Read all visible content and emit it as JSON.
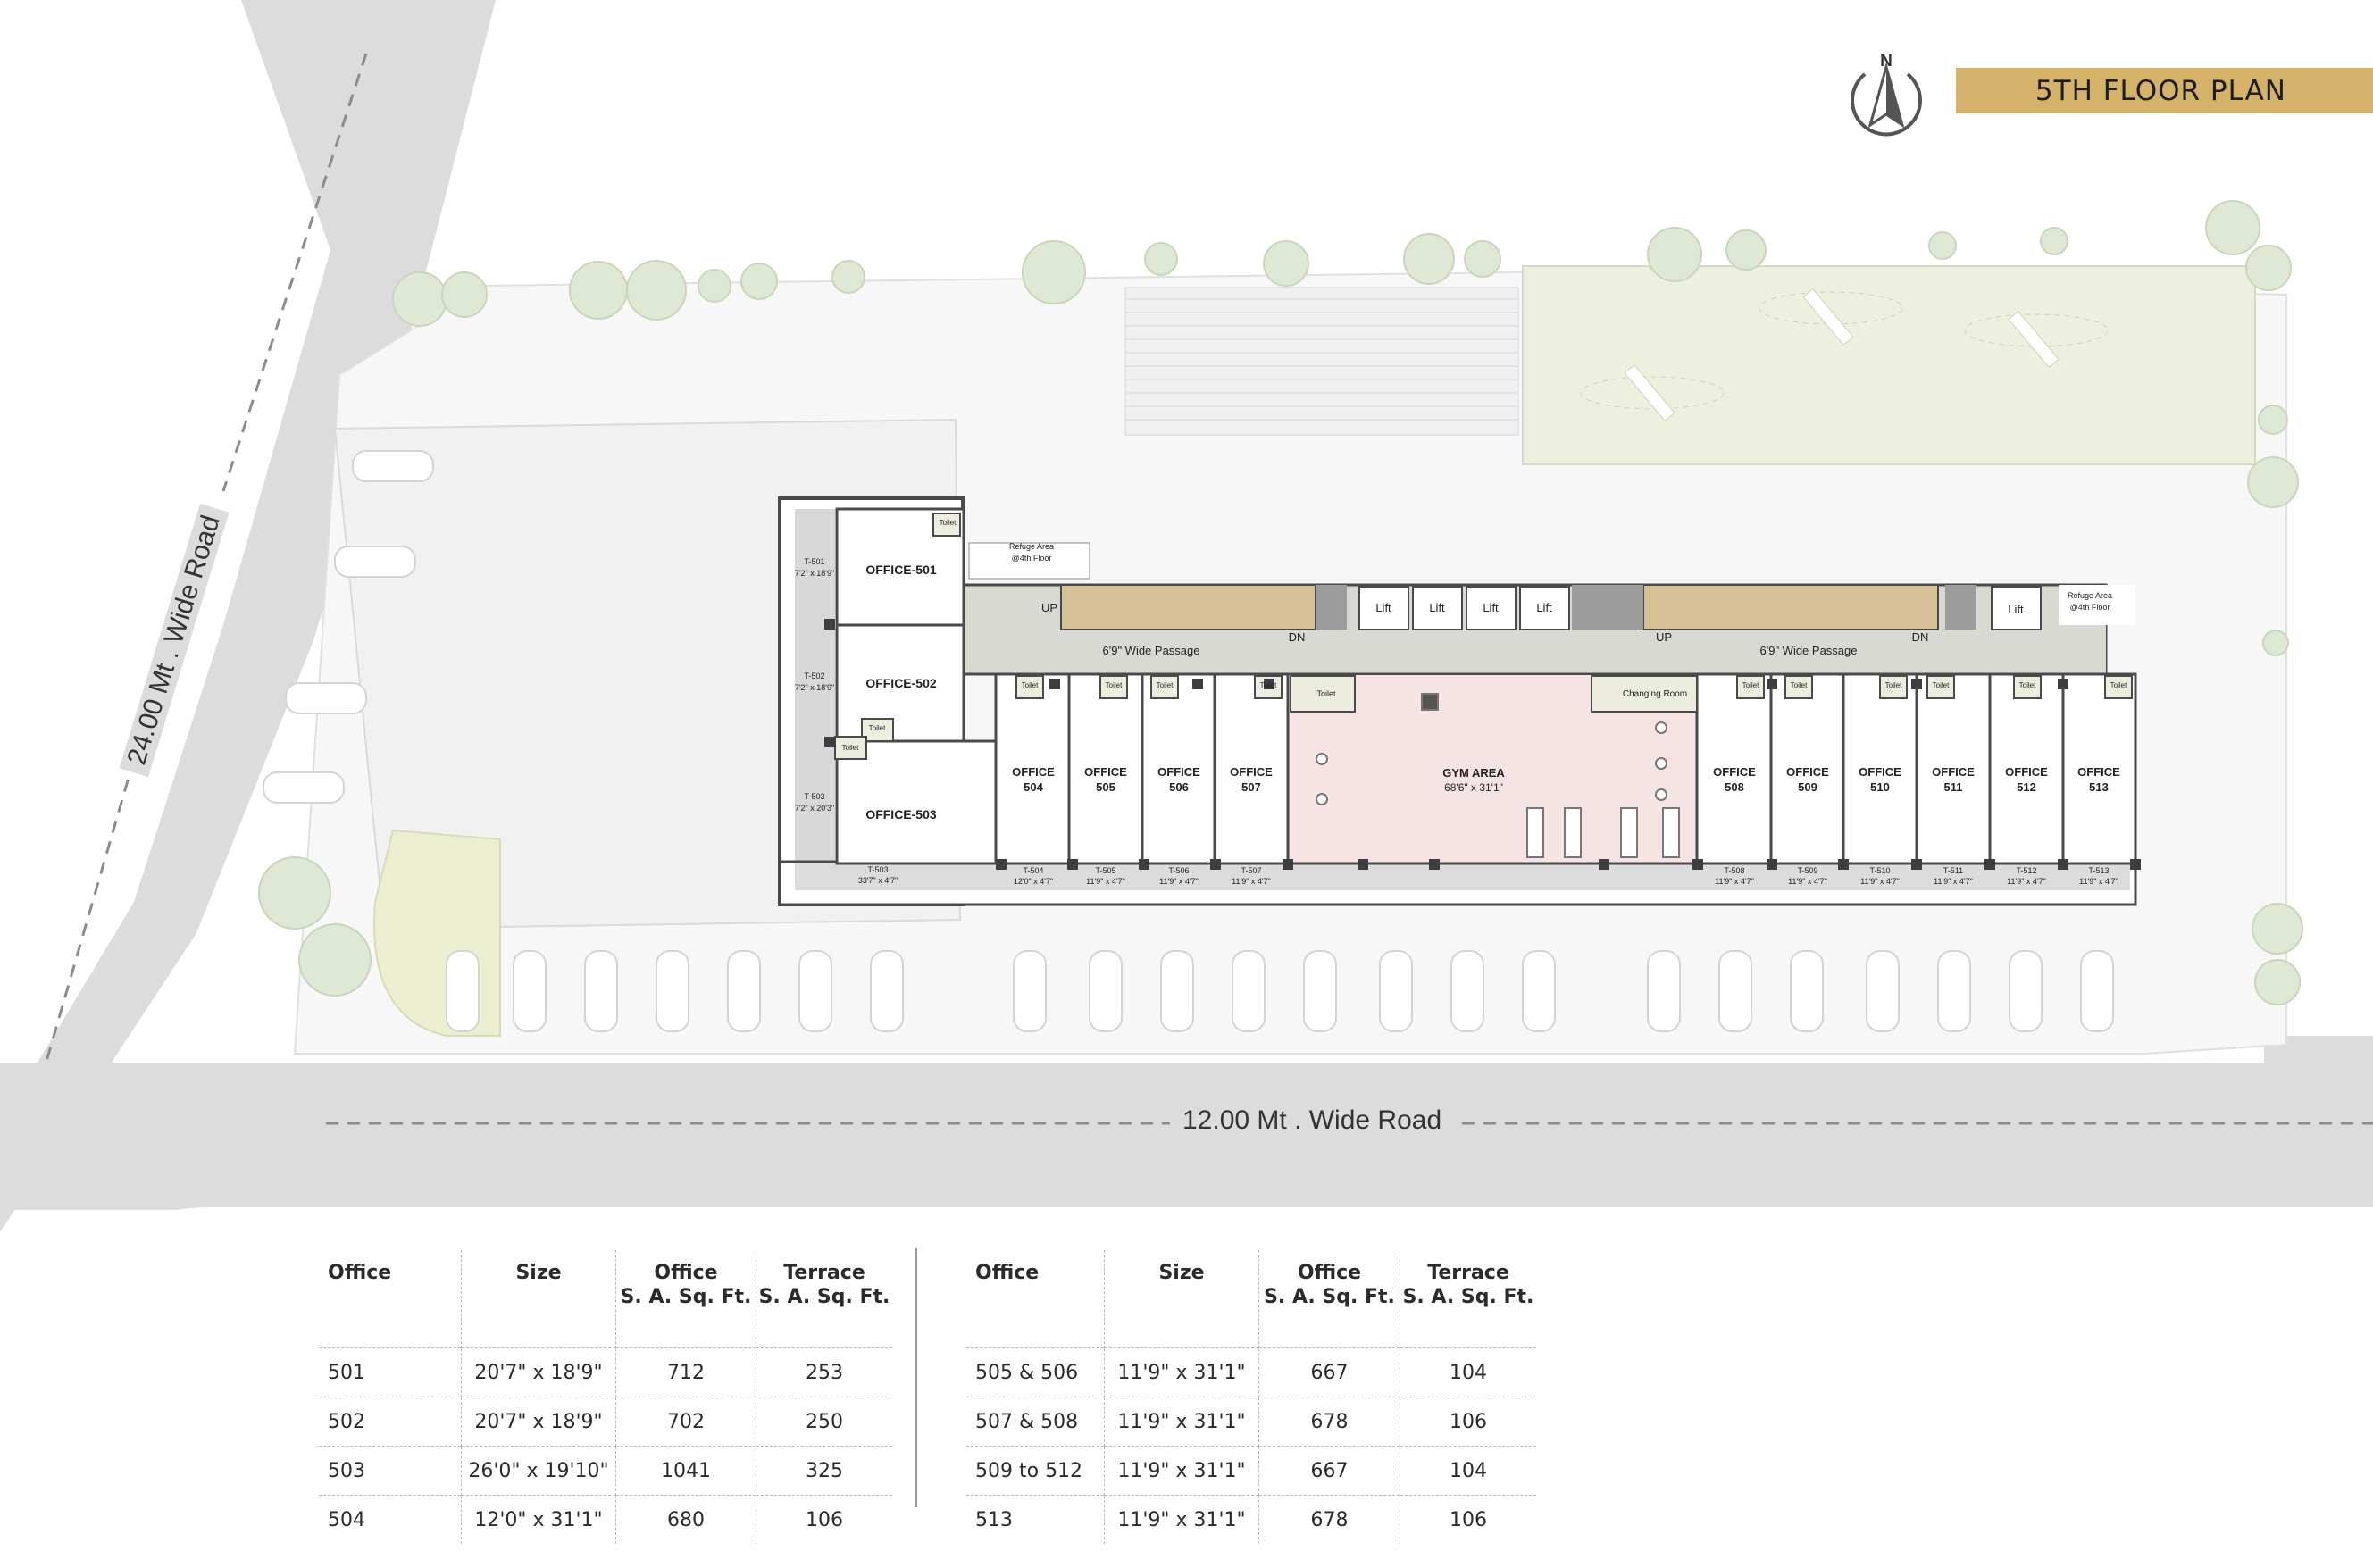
{
  "header": {
    "title": "5TH FLOOR PLAN",
    "north_label": "N"
  },
  "roads": {
    "bottom": "12.00 Mt . Wide Road",
    "left": "24.00 Mt . Wide Road"
  },
  "plan": {
    "offices_left": [
      {
        "name": "OFFICE-501",
        "terrace": "T-501",
        "terrace_size": "7'2\" x 18'9\""
      },
      {
        "name": "OFFICE-502",
        "terrace": "T-502",
        "terrace_size": "7'2\" x 18'9\""
      },
      {
        "name": "OFFICE-503",
        "terrace": "T-503",
        "terrace_size": "7'2\" x 20'3\""
      }
    ],
    "t503_bottom": "33'7\" x 4'7\"",
    "offices_row": [
      {
        "line1": "OFFICE",
        "line2": "504",
        "terrace": "T-504",
        "size": "12'0\" x 4'7\""
      },
      {
        "line1": "OFFICE",
        "line2": "505",
        "terrace": "T-505",
        "size": "11'9\" x 4'7\""
      },
      {
        "line1": "OFFICE",
        "line2": "506",
        "terrace": "T-506",
        "size": "11'9\" x 4'7\""
      },
      {
        "line1": "OFFICE",
        "line2": "507",
        "terrace": "T-507",
        "size": "11'9\" x 4'7\""
      }
    ],
    "offices_right": [
      {
        "line1": "OFFICE",
        "line2": "508",
        "terrace": "T-508",
        "size": "11'9\" x 4'7\""
      },
      {
        "line1": "OFFICE",
        "line2": "509",
        "terrace": "T-509",
        "size": "11'9\" x 4'7\""
      },
      {
        "line1": "OFFICE",
        "line2": "510",
        "terrace": "T-510",
        "size": "11'9\" x 4'7\""
      },
      {
        "line1": "OFFICE",
        "line2": "511",
        "terrace": "T-511",
        "size": "11'9\" x 4'7\""
      },
      {
        "line1": "OFFICE",
        "line2": "512",
        "terrace": "T-512",
        "size": "11'9\" x 4'7\""
      },
      {
        "line1": "OFFICE",
        "line2": "513",
        "terrace": "T-513",
        "size": "11'9\" x 4'7\""
      }
    ],
    "gym": {
      "name": "GYM AREA",
      "size": "68'6\" x 31'1\""
    },
    "changing_room": "Changing Room",
    "toilet": "Toilet",
    "lift": "Lift",
    "passage": "6'9\" Wide Passage",
    "up": "UP",
    "dn": "DN",
    "refuge_line1": "Refuge Area",
    "refuge_line2": "@4th Floor"
  },
  "table_headers": {
    "office": "Office",
    "size": "Size",
    "office_area_1": "Office",
    "office_area_2": "S. A. Sq. Ft.",
    "terrace_area_1": "Terrace",
    "terrace_area_2": "S. A. Sq. Ft."
  },
  "table_left": [
    {
      "office": "501",
      "size": "20'7\" x 18'9\"",
      "office_sa": "712",
      "terrace_sa": "253"
    },
    {
      "office": "502",
      "size": "20'7\" x 18'9\"",
      "office_sa": "702",
      "terrace_sa": "250"
    },
    {
      "office": "503",
      "size": "26'0\" x 19'10\"",
      "office_sa": "1041",
      "terrace_sa": "325"
    },
    {
      "office": "504",
      "size": "12'0\" x 31'1\"",
      "office_sa": "680",
      "terrace_sa": "106"
    }
  ],
  "table_right": [
    {
      "office": "505 & 506",
      "size": "11'9\" x 31'1\"",
      "office_sa": "667",
      "terrace_sa": "104"
    },
    {
      "office": "507 & 508",
      "size": "11'9\" x 31'1\"",
      "office_sa": "678",
      "terrace_sa": "106"
    },
    {
      "office": "509 to 512",
      "size": "11'9\" x 31'1\"",
      "office_sa": "667",
      "terrace_sa": "104"
    },
    {
      "office": "513",
      "size": "11'9\" x 31'1\"",
      "office_sa": "678",
      "terrace_sa": "106"
    }
  ],
  "colors": {
    "accent": "#d4b26a",
    "gym": "#f6e3e4",
    "stairs": "#d7bf96",
    "passage": "#d9d9d4",
    "lawn": "#eef0df",
    "road": "#dcdcdc"
  }
}
